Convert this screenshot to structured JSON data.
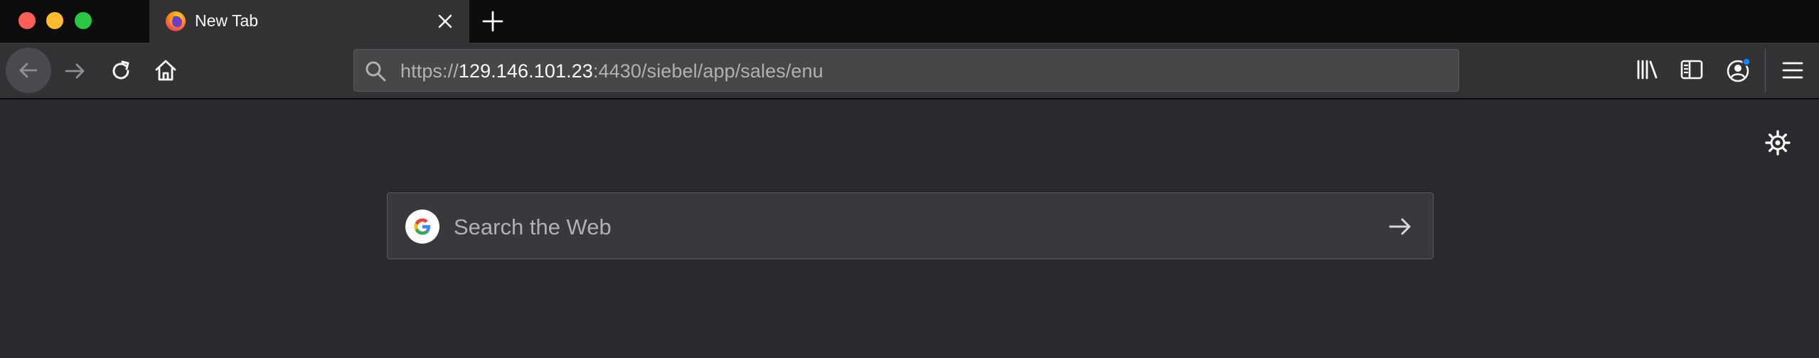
{
  "window": {
    "controls": [
      "close",
      "minimize",
      "zoom"
    ],
    "colors": {
      "close": "#fe5f57",
      "minimize": "#febc2e",
      "zoom": "#28c840"
    }
  },
  "tabs": [
    {
      "title": "New Tab",
      "active": true,
      "icon": "firefox-icon"
    }
  ],
  "navbar": {
    "back_icon": "back-arrow-icon",
    "forward_icon": "forward-arrow-icon",
    "reload_icon": "reload-icon",
    "home_icon": "home-icon",
    "url": {
      "scheme": "https://",
      "host": "129.146.101.23",
      "rest": ":4430/siebel/app/sales/enu"
    },
    "right_icons": [
      "library-icon",
      "sidebar-icon",
      "account-icon",
      "hamburger-menu-icon"
    ]
  },
  "content": {
    "search": {
      "placeholder": "Search the Web",
      "engine_icon": "google-icon",
      "submit_icon": "arrow-right-icon"
    },
    "settings_icon": "gear-icon"
  },
  "theme": {
    "tabstrip_bg": "#0c0c0d",
    "toolbar_bg": "#323234",
    "content_bg": "#2a2a2e",
    "accent_dot": "#0a84ff"
  }
}
